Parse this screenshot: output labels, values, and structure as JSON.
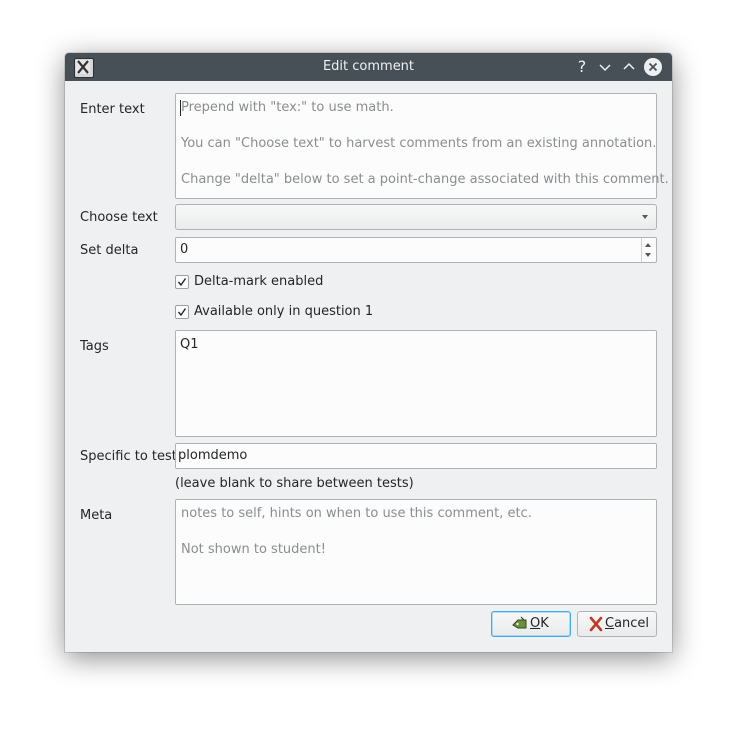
{
  "window": {
    "title": "Edit comment",
    "help_glyph": "?",
    "minimize_glyph": "⌄",
    "maximize_glyph": "⌃"
  },
  "form": {
    "enter_text": {
      "label": "Enter text",
      "placeholder_lines": [
        "Prepend with \"tex:\" to use math.",
        "You can \"Choose text\" to harvest comments from an existing annotation.",
        "Change \"delta\" below to set a point-change associated with this comment."
      ]
    },
    "choose_text": {
      "label": "Choose text",
      "value": ""
    },
    "set_delta": {
      "label": "Set delta",
      "value": "0"
    },
    "delta_mark": {
      "label": "Delta-mark enabled",
      "checked": true
    },
    "question_only": {
      "label": "Available only in question 1",
      "checked": true
    },
    "tags": {
      "label": "Tags",
      "value": "Q1"
    },
    "specific_to_test": {
      "label": "Specific to test",
      "value": "plomdemo"
    },
    "share_note": "(leave blank to share between tests)",
    "meta": {
      "label": "Meta",
      "placeholder_lines": [
        "notes to self, hints on when to use this comment, etc.",
        "Not shown to student!"
      ]
    }
  },
  "buttons": {
    "ok": {
      "accel": "O",
      "rest": "K",
      "icon": "ok-icon"
    },
    "cancel": {
      "accel": "C",
      "rest": "ancel",
      "icon": "cancel-icon"
    }
  },
  "colors": {
    "titlebar": "#475057",
    "dialog_bg": "#eff0f1",
    "focus": "#3daee9",
    "cancel_red": "#c0392b",
    "ok_green": "#4a7a2a"
  }
}
